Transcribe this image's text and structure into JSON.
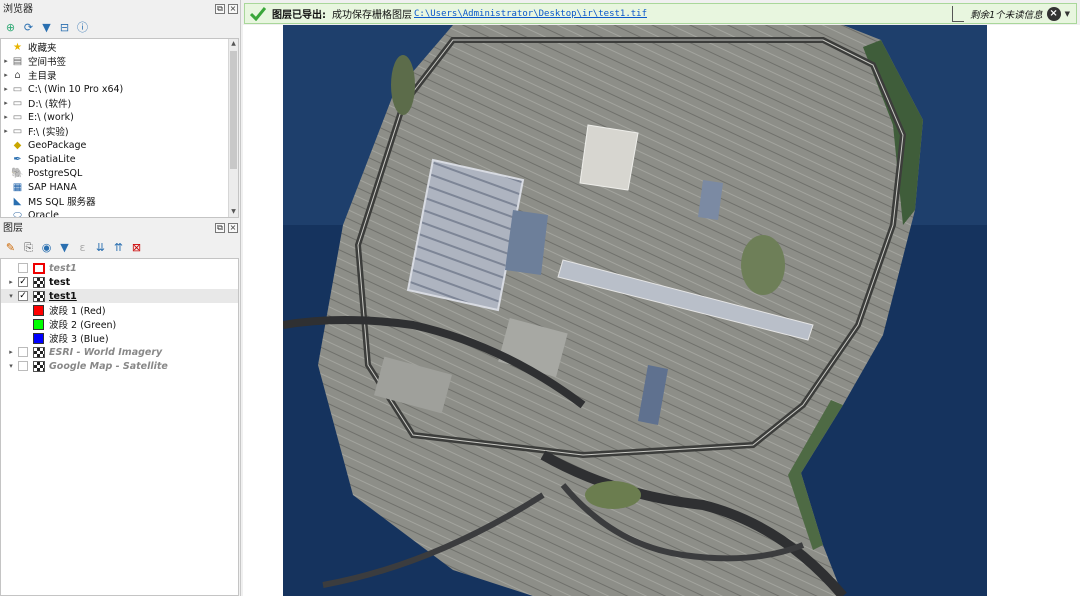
{
  "browser": {
    "title": "浏览器",
    "items": [
      {
        "label": "收藏夹",
        "icon": "star-icon",
        "has_arrow": false
      },
      {
        "label": "空间书签",
        "icon": "bookmark-icon",
        "has_arrow": true
      },
      {
        "label": "主目录",
        "icon": "home-icon",
        "has_arrow": true
      },
      {
        "label": "C:\\ (Win 10 Pro x64)",
        "icon": "folder-icon",
        "has_arrow": true
      },
      {
        "label": "D:\\ (软件)",
        "icon": "folder-icon",
        "has_arrow": true
      },
      {
        "label": "E:\\ (work)",
        "icon": "folder-icon",
        "has_arrow": true
      },
      {
        "label": "F:\\ (实验)",
        "icon": "folder-icon",
        "has_arrow": true
      },
      {
        "label": "GeoPackage",
        "icon": "geopackage-icon",
        "has_arrow": false
      },
      {
        "label": "SpatiaLite",
        "icon": "spatialite-icon",
        "has_arrow": false
      },
      {
        "label": "PostgreSQL",
        "icon": "postgresql-icon",
        "has_arrow": false
      },
      {
        "label": "SAP HANA",
        "icon": "sap-hana-icon",
        "has_arrow": false
      },
      {
        "label": "MS SQL 服务器",
        "icon": "mssql-icon",
        "has_arrow": false
      },
      {
        "label": "Oracle",
        "icon": "oracle-icon",
        "has_arrow": false
      }
    ]
  },
  "layers": {
    "title": "图层",
    "items": [
      {
        "label": "test1",
        "checked": false,
        "style": "gray-italic",
        "icon": "red-outline-icon",
        "arrow": ""
      },
      {
        "label": "test",
        "checked": true,
        "style": "bold",
        "icon": "raster-icon",
        "arrow": "▸"
      },
      {
        "label": "test1",
        "checked": true,
        "style": "bold-ul",
        "icon": "raster-icon",
        "arrow": "▾"
      },
      {
        "label": "波段 1 (Red)",
        "band_color": "#ff0000"
      },
      {
        "label": "波段 2 (Green)",
        "band_color": "#00ff00"
      },
      {
        "label": "波段 3 (Blue)",
        "band_color": "#0000ff"
      },
      {
        "label": "ESRI - World Imagery",
        "checked": false,
        "style": "gray-italic",
        "icon": "raster-icon",
        "arrow": "▸"
      },
      {
        "label": "Google Map - Satellite",
        "checked": false,
        "style": "gray-italic",
        "icon": "raster-icon",
        "arrow": "▾"
      }
    ]
  },
  "message_bar": {
    "title": "图层已导出:",
    "message": "成功保存栅格图层",
    "path": "C:\\Users\\Administrator\\Desktop\\ir\\test1.tif",
    "remaining": "剩余1个未读信息"
  },
  "colors": {
    "success_bg": "#e8f6df",
    "water": "#15335e",
    "land": "#8a8b86"
  }
}
